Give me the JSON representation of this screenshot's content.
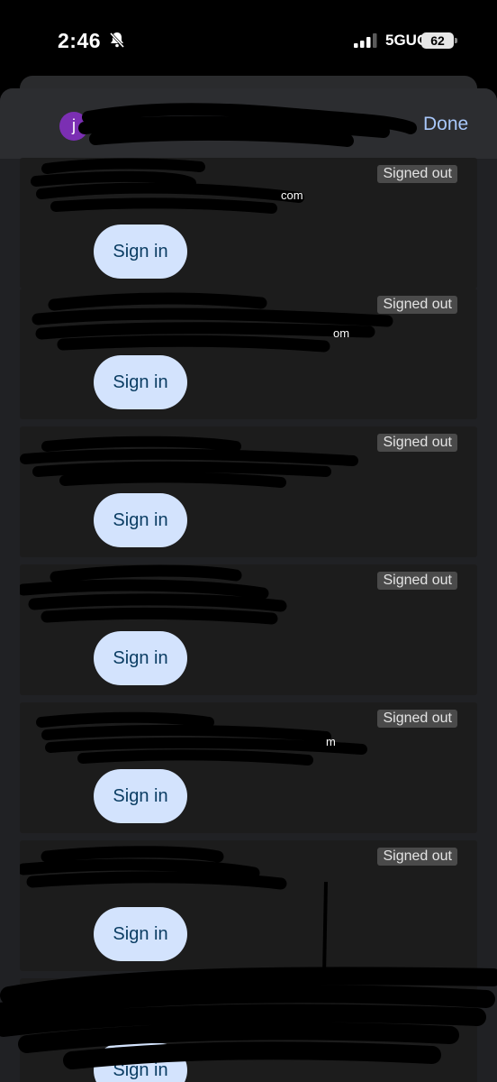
{
  "status_bar": {
    "time": "2:46",
    "network": "5GUC",
    "battery": "62"
  },
  "header": {
    "avatar_letter": "j",
    "done_label": "Done"
  },
  "accounts": [
    {
      "status": "Signed out",
      "button": "Sign in",
      "email_tail": "com"
    },
    {
      "status": "Signed out",
      "button": "Sign in",
      "email_tail": "om"
    },
    {
      "status": "Signed out",
      "button": "Sign in",
      "email_tail": ""
    },
    {
      "status": "Signed out",
      "button": "Sign in",
      "email_tail": ""
    },
    {
      "status": "Signed out",
      "button": "Sign in",
      "email_tail": "m"
    },
    {
      "status": "Signed out",
      "button": "Sign in",
      "email_tail": ""
    },
    {
      "status": "",
      "button": "Sign in",
      "email_tail": ""
    }
  ],
  "colors": {
    "accent": "#a8c7fa",
    "button_bg": "#d3e3fd",
    "button_text": "#0b3d63",
    "avatar": "#7b2fb3"
  }
}
